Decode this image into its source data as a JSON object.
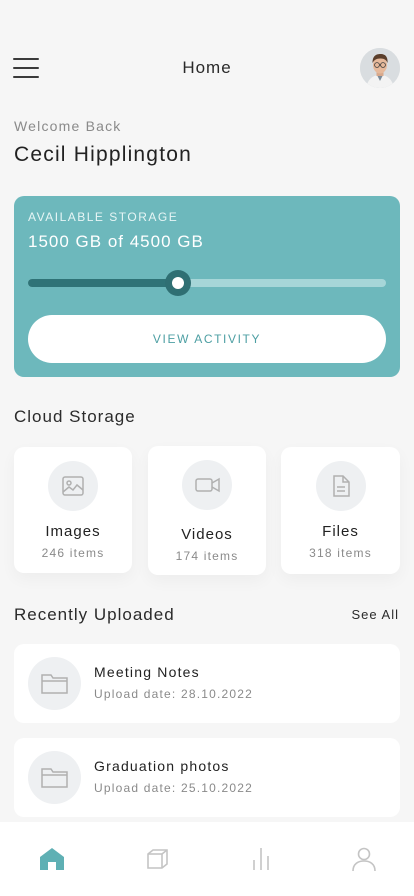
{
  "header": {
    "title": "Home",
    "menu_icon": "hamburger-menu-icon",
    "avatar_icon": "user-avatar"
  },
  "welcome": {
    "greeting": "Welcome Back",
    "name": "Cecil Hipplington"
  },
  "storage": {
    "label": "AVAILABLE STORAGE",
    "value_text": "1500 GB of 4500 GB",
    "used_fraction": 0.42,
    "button_label": "VIEW ACTIVITY",
    "card_color": "#6db8bc",
    "accent_color": "#2f7377"
  },
  "cloud_storage": {
    "title": "Cloud Storage",
    "categories": [
      {
        "name": "Images",
        "count": "246 items",
        "icon": "image-icon"
      },
      {
        "name": "Videos",
        "count": "174 items",
        "icon": "video-camera-icon"
      },
      {
        "name": "Files",
        "count": "318 items",
        "icon": "file-icon"
      }
    ]
  },
  "recent": {
    "title": "Recently Uploaded",
    "see_all_label": "See All",
    "items": [
      {
        "name": "Meeting Notes",
        "date": "Upload date: 28.10.2022",
        "icon": "folder-icon"
      },
      {
        "name": "Graduation photos",
        "date": "Upload date: 25.10.2022",
        "icon": "folder-icon"
      }
    ]
  },
  "tabbar": {
    "tabs": [
      {
        "name": "home",
        "icon": "home-icon",
        "active": true
      },
      {
        "name": "folders",
        "icon": "folders-icon",
        "active": false
      },
      {
        "name": "stats",
        "icon": "bar-chart-icon",
        "active": false
      },
      {
        "name": "profile",
        "icon": "profile-icon",
        "active": false
      }
    ],
    "active_color": "#5fb0b4",
    "inactive_color": "#c4c4c4"
  }
}
